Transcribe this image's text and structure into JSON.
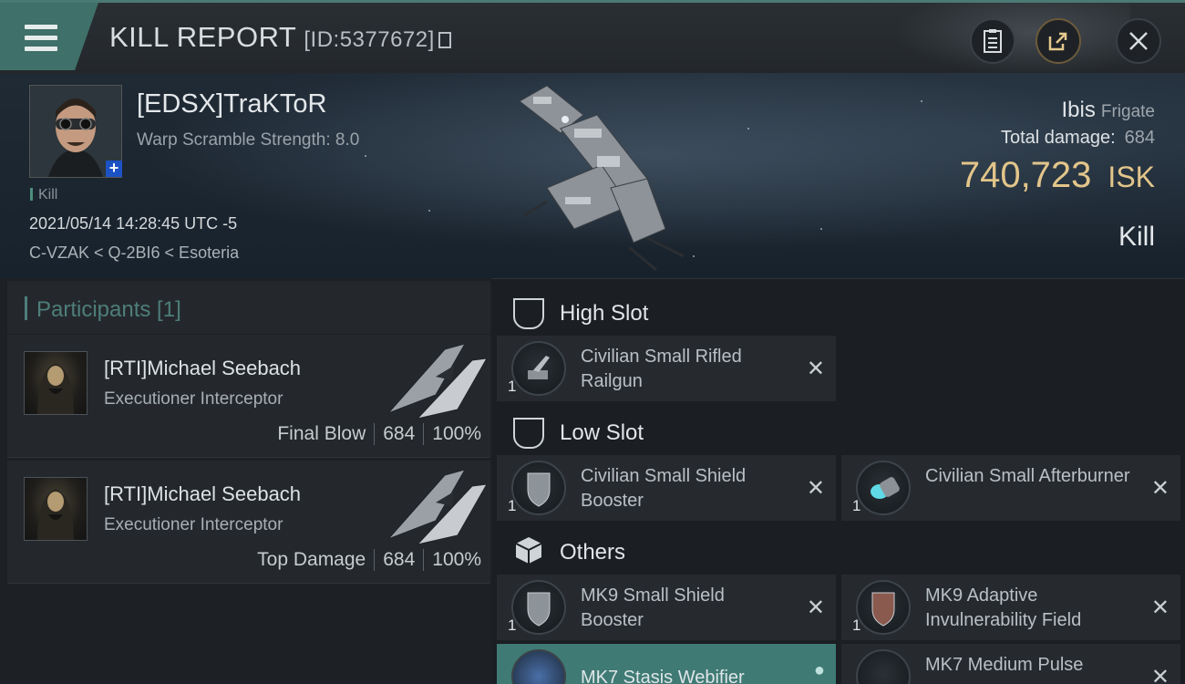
{
  "header": {
    "title": "KILL REPORT",
    "report_id": "[ID:5377672]"
  },
  "victim": {
    "name": "[EDSX]TraKToR",
    "warp_scramble": "Warp Scramble Strength: 8.0",
    "tag": "Kill",
    "datetime": "2021/05/14 14:28:45 UTC -5",
    "location": "C-VZAK < Q-2BI6 < Esoteria",
    "ship": "Ibis",
    "ship_class": "Frigate",
    "total_damage_label": "Total damage:",
    "total_damage": "684",
    "isk_value": "740,723",
    "isk_unit": "ISK",
    "result": "Kill"
  },
  "participants": {
    "title": "Participants [1]",
    "rows": [
      {
        "name": "[RTI]Michael Seebach",
        "ship": "Executioner Interceptor",
        "role": "Final Blow",
        "damage": "684",
        "percent": "100%"
      },
      {
        "name": "[RTI]Michael Seebach",
        "ship": "Executioner Interceptor",
        "role": "Top Damage",
        "damage": "684",
        "percent": "100%"
      }
    ]
  },
  "slots": {
    "high": {
      "label": "High Slot",
      "items": [
        {
          "name": "Civilian Small Rifled Railgun",
          "qty": "1"
        }
      ]
    },
    "low": {
      "label": "Low Slot",
      "items": [
        {
          "name": "Civilian Small Shield Booster",
          "qty": "1"
        },
        {
          "name": "Civilian Small Afterburner",
          "qty": "1"
        }
      ]
    },
    "others": {
      "label": "Others",
      "items": [
        {
          "name": "MK9 Small Shield Booster",
          "qty": "1"
        },
        {
          "name": "MK9 Adaptive Invulnerability Field",
          "qty": "1"
        },
        {
          "name": "MK7 Stasis Webifier",
          "qty": ""
        },
        {
          "name": "MK7 Medium Pulse",
          "qty": ""
        }
      ]
    }
  },
  "icons": {
    "menu": "hamburger-menu-icon",
    "notes": "clipboard-icon",
    "share": "share-icon",
    "close": "close-icon"
  }
}
